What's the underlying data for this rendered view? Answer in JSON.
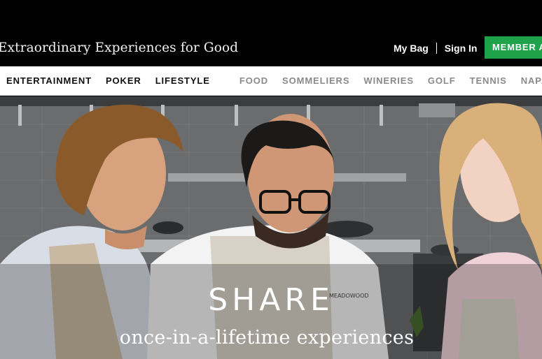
{
  "header": {
    "tagline": "Extraordinary Experiences for Good",
    "my_bag": "My Bag",
    "sign_in": "Sign In",
    "member_button": "MEMBER A"
  },
  "nav": {
    "primary": [
      "ENTERTAINMENT",
      "POKER",
      "LIFESTYLE"
    ],
    "secondary": [
      "FOOD",
      "SOMMELIERS",
      "WINERIES",
      "GOLF",
      "TENNIS",
      "NAPA"
    ]
  },
  "hero": {
    "title": "SHARE",
    "subtitle": "once-in-a-lifetime experiences",
    "apron_text": "MEADOWOOD"
  },
  "colors": {
    "accent": "#1fa34a",
    "topbar": "#000000",
    "nav_primary": "#111111",
    "nav_secondary": "#8a8a8a"
  }
}
